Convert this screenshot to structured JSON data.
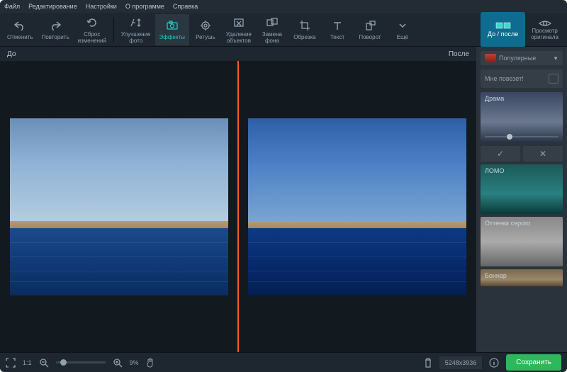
{
  "menu": {
    "file": "Файл",
    "edit": "Редактирование",
    "settings": "Настройки",
    "about": "О программе",
    "help": "Справка"
  },
  "tools": {
    "undo": "Отменить",
    "redo": "Повторить",
    "reset": "Сброс\nизменений",
    "enhance": "Улучшение\nфото",
    "effects": "Эффекты",
    "retouch": "Ретушь",
    "remove": "Удаление\nобъектов",
    "bgswap": "Замена\nфона",
    "crop": "Обрезка",
    "text": "Текст",
    "rotate": "Поворот",
    "more": "Ещё"
  },
  "compare": {
    "before": "До",
    "after": "После",
    "button": "До / после",
    "viewOriginal": "Просмотр\nоригинала"
  },
  "sidebar": {
    "category": "Популярные",
    "lucky": "Мне повезет!",
    "effects": [
      "Драма",
      "ЛОМО",
      "Оттенки серого",
      "Боннар"
    ]
  },
  "status": {
    "scale": "1:1",
    "zoom": "9%",
    "dimensions": "5248x3936",
    "save": "Сохранить"
  }
}
